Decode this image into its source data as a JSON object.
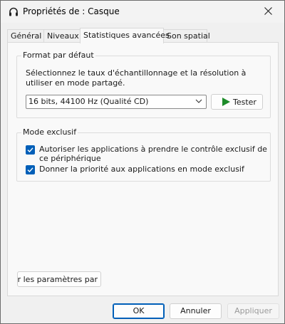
{
  "window": {
    "title": "Propriétés de : Casque",
    "icons": {
      "app": "headphones-icon",
      "close": "close-icon"
    }
  },
  "tabs": [
    {
      "label": "Général"
    },
    {
      "label": "Niveaux"
    },
    {
      "label": "Statistiques avancées",
      "active": true
    },
    {
      "label": "Son spatial"
    }
  ],
  "default_format": {
    "group_label": "Format par défaut",
    "description": "Sélectionnez le taux d'échantillonnage et la résolution à utiliser en mode partagé.",
    "selected_format": "16 bits, 44100 Hz (Qualité CD)",
    "test_button": "Tester"
  },
  "exclusive_mode": {
    "group_label": "Mode exclusif",
    "options": [
      {
        "label": "Autoriser les applications à prendre le contrôle exclusif de ce périphérique",
        "checked": true
      },
      {
        "label": "Donner la priorité aux applications en mode exclusif",
        "checked": true
      }
    ]
  },
  "restore_button": "rer les paramètres par",
  "footer": {
    "ok": "OK",
    "cancel": "Annuler",
    "apply": "Appliquer"
  },
  "colors": {
    "accent": "#005fb8",
    "play": "#1e8c2a"
  }
}
